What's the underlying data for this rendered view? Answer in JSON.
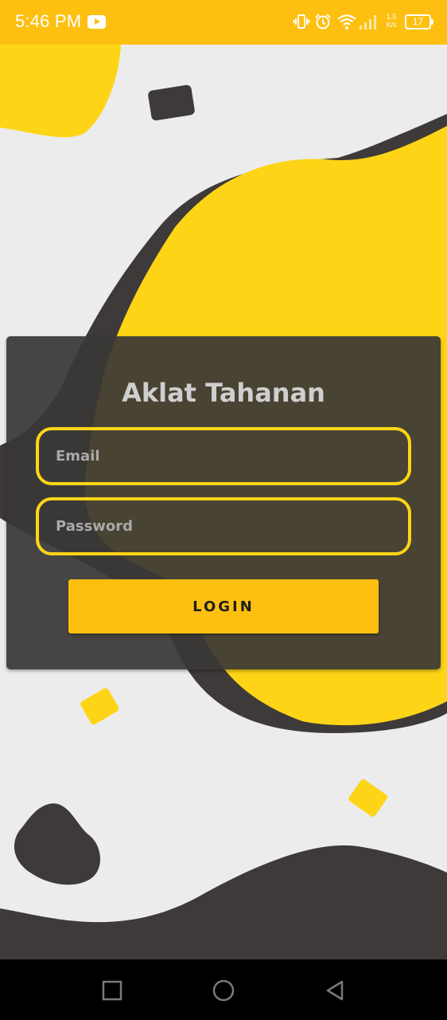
{
  "status_bar": {
    "time": "5:46 PM",
    "speed_value": "1.5",
    "speed_unit": "K/s",
    "battery": "17",
    "icons": [
      "youtube-icon",
      "vibrate-icon",
      "alarm-icon",
      "wifi-icon",
      "signal-icon",
      "battery-icon"
    ]
  },
  "login": {
    "title": "Aklat Tahanan",
    "email_placeholder": "Email",
    "password_placeholder": "Password",
    "button_label": "LOGIN"
  },
  "nav_bar": {
    "icons": [
      "recent-apps-icon",
      "home-icon",
      "back-icon"
    ]
  },
  "theme": {
    "accent": "#fdc010",
    "yellow_blob": "#fdd516",
    "dark_blob": "#3e3a39",
    "card": "#3a3836",
    "background": "#ececec"
  }
}
